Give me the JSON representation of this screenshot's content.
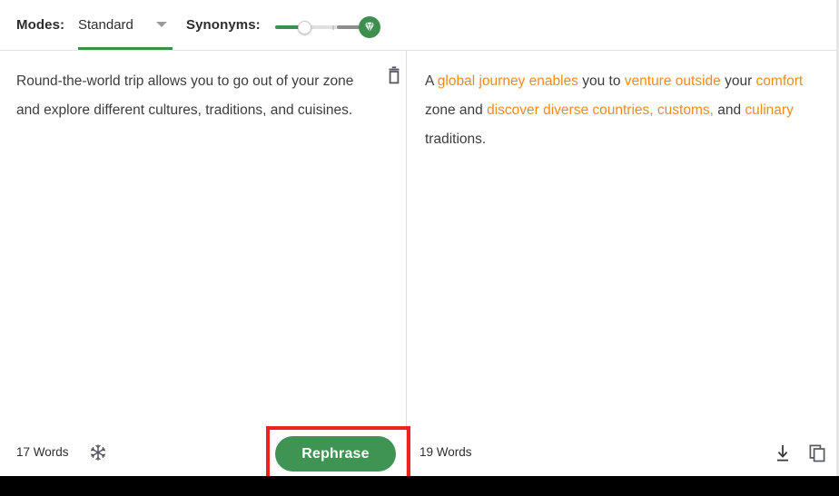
{
  "toolbar": {
    "modes_label": "Modes:",
    "mode_selected": "Standard",
    "caret_icon": "chevron-down-icon",
    "synonyms_label": "Synonyms:",
    "slider": {
      "fill_color": "#3e8e4e",
      "track_color": "#e0e0e0",
      "premium_segment_color": "#8d8d8d",
      "gem_icon": "diamond-gem-icon"
    }
  },
  "input_panel": {
    "text": "Round-the-world trip allows you to go out of your zone and explore different cultures, traditions, and cuisines.",
    "delete_icon": "trash-icon",
    "word_count": "17 Words",
    "freeze_icon": "snowflake-icon"
  },
  "output_panel": {
    "segments": [
      {
        "text": "A ",
        "highlight": false
      },
      {
        "text": "global journey enables",
        "highlight": true
      },
      {
        "text": " you to ",
        "highlight": false
      },
      {
        "text": "venture outside",
        "highlight": true
      },
      {
        "text": " your ",
        "highlight": false
      },
      {
        "text": "comfort",
        "highlight": true
      },
      {
        "text": " zone and ",
        "highlight": false
      },
      {
        "text": "discover diverse countries, customs,",
        "highlight": true
      },
      {
        "text": " and ",
        "highlight": false
      },
      {
        "text": "culinary",
        "highlight": true
      },
      {
        "text": " traditions.",
        "highlight": false
      }
    ],
    "word_count": "19 Words",
    "download_icon": "download-icon",
    "copy_icon": "copy-icon"
  },
  "action": {
    "rephrase_label": "Rephrase",
    "button_color": "#3f9454",
    "highlight_color": "#e8241c"
  },
  "colors": {
    "accent_green": "#3e8e4e",
    "synonym_orange": "#ef8c1f",
    "text_dark": "#3c3c3c"
  }
}
